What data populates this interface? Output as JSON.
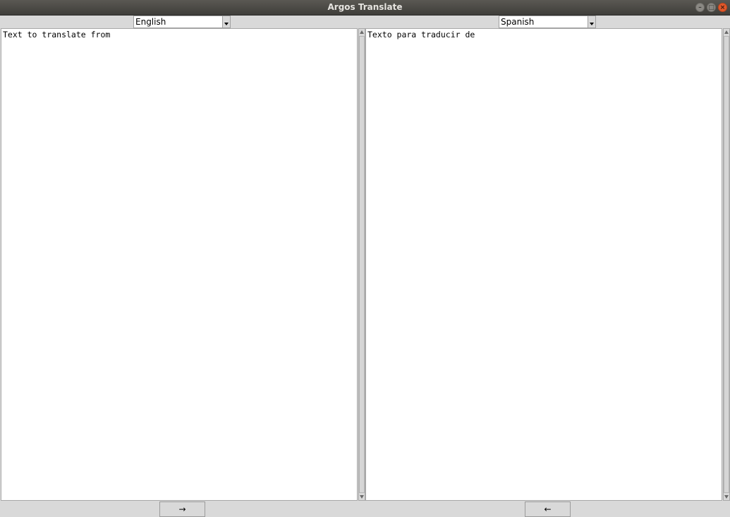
{
  "window": {
    "title": "Argos Translate",
    "minimize_icon": "minimize-icon",
    "maximize_icon": "maximize-icon",
    "close_icon": "close-icon"
  },
  "source": {
    "language": "English",
    "text": "Text to translate from"
  },
  "target": {
    "language": "Spanish",
    "text": "Texto para traducir de"
  },
  "buttons": {
    "translate_forward": "→",
    "translate_backward": "←"
  },
  "colors": {
    "close_button": "#e1582a",
    "titlebar": "#4a4945",
    "background": "#d9d9d9"
  }
}
